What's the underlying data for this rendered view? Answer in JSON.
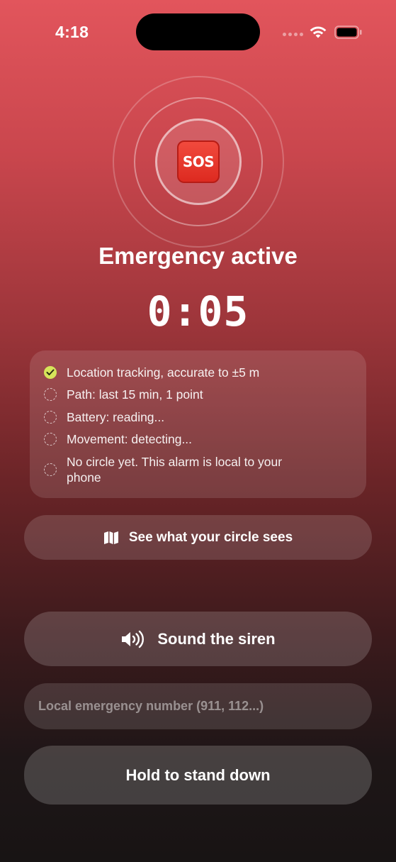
{
  "status_bar": {
    "time": "4:18",
    "icons": [
      "signal-icon",
      "wifi-icon",
      "battery-icon"
    ]
  },
  "emergency": {
    "badge": "SOS",
    "title": "Emergency active",
    "timer": "0:05"
  },
  "status_list": [
    {
      "text": "Location tracking, accurate to ±5 m",
      "state": "done"
    },
    {
      "text": "Path: last 15 min, 1 point",
      "state": "pending"
    },
    {
      "text": "Battery: reading...",
      "state": "pending"
    },
    {
      "text": "Movement: detecting...",
      "state": "pending"
    },
    {
      "text": "No circle yet. This alarm is local to your phone",
      "state": "pending"
    }
  ],
  "actions": {
    "circle_label": "See what your circle sees",
    "siren_label": "Sound the siren",
    "emergency_number_placeholder": "Local emergency number (911, 112...)",
    "emergency_number_value": "",
    "stand_down_label": "Hold to stand down"
  },
  "colors": {
    "background_top": "#e2555c",
    "background_bottom": "#181414",
    "check_accent": "#d6e45a",
    "sos_red": "#e8342a"
  }
}
